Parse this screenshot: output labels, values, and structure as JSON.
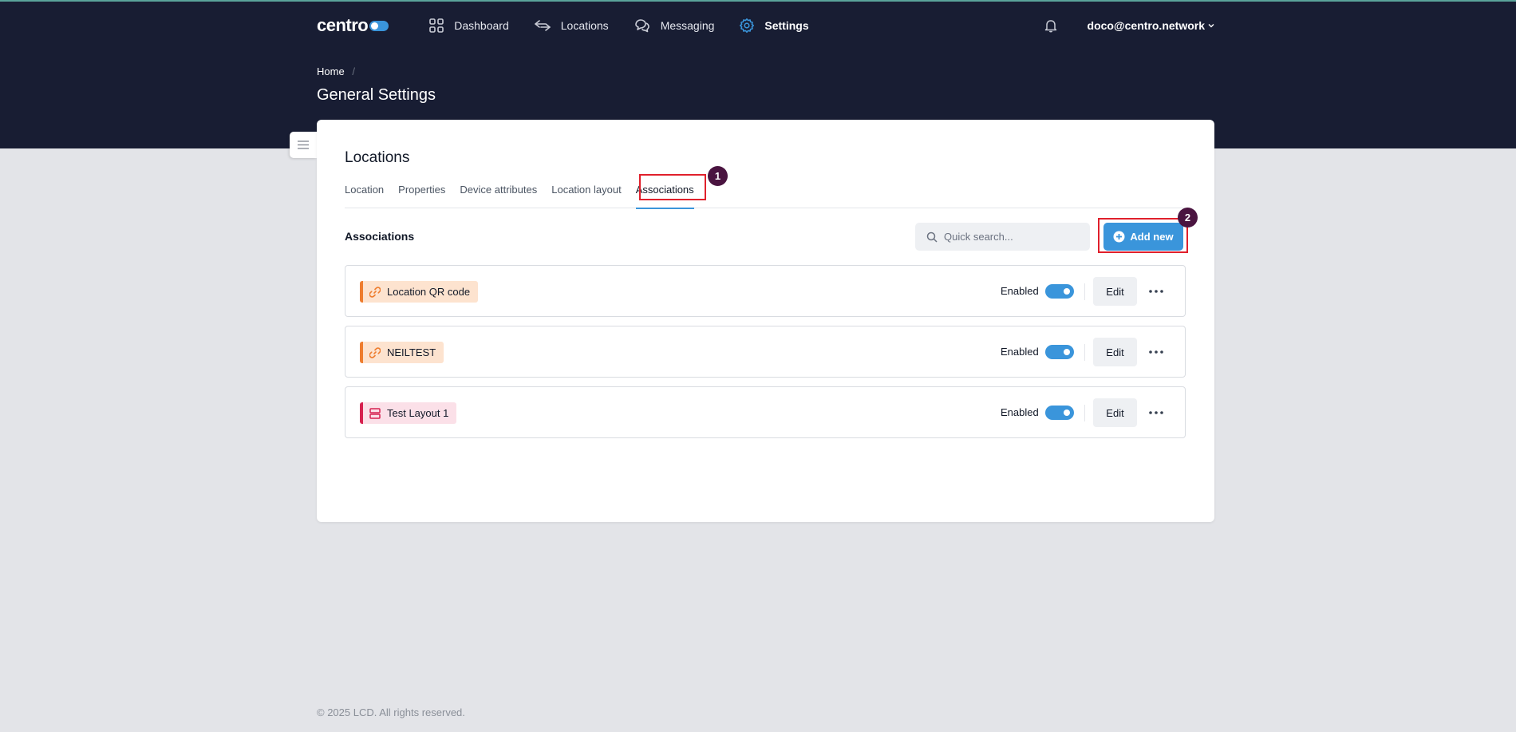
{
  "nav": {
    "logo_text": "centro",
    "items": [
      {
        "label": "Dashboard",
        "icon": "grid-icon"
      },
      {
        "label": "Locations",
        "icon": "arrows-icon"
      },
      {
        "label": "Messaging",
        "icon": "chat-icon"
      },
      {
        "label": "Settings",
        "icon": "gear-icon",
        "active": true
      }
    ],
    "user_email": "doco@centro.network"
  },
  "breadcrumb": {
    "home": "Home",
    "separator": "/"
  },
  "page_title": "General Settings",
  "card": {
    "title": "Locations",
    "tabs": [
      "Location",
      "Properties",
      "Device attributes",
      "Location layout",
      "Associations"
    ],
    "active_tab": "Associations",
    "section_title": "Associations",
    "search_placeholder": "Quick search...",
    "add_button": "Add new",
    "rows": [
      {
        "name": "Location QR code",
        "type": "link",
        "status": "Enabled",
        "enabled": true,
        "edit": "Edit"
      },
      {
        "name": "NEILTEST",
        "type": "link",
        "status": "Enabled",
        "enabled": true,
        "edit": "Edit"
      },
      {
        "name": "Test Layout 1",
        "type": "layout",
        "status": "Enabled",
        "enabled": true,
        "edit": "Edit"
      }
    ]
  },
  "annotations": {
    "badge_1": "1",
    "badge_2": "2"
  },
  "footer": "© 2025 LCD. All rights reserved.",
  "colors": {
    "header_bg": "#181d33",
    "accent": "#3a95db",
    "highlight": "#e0202c",
    "badge": "#4a1440",
    "link_chip": "#ee7d2f",
    "layout_chip": "#d6214f"
  }
}
